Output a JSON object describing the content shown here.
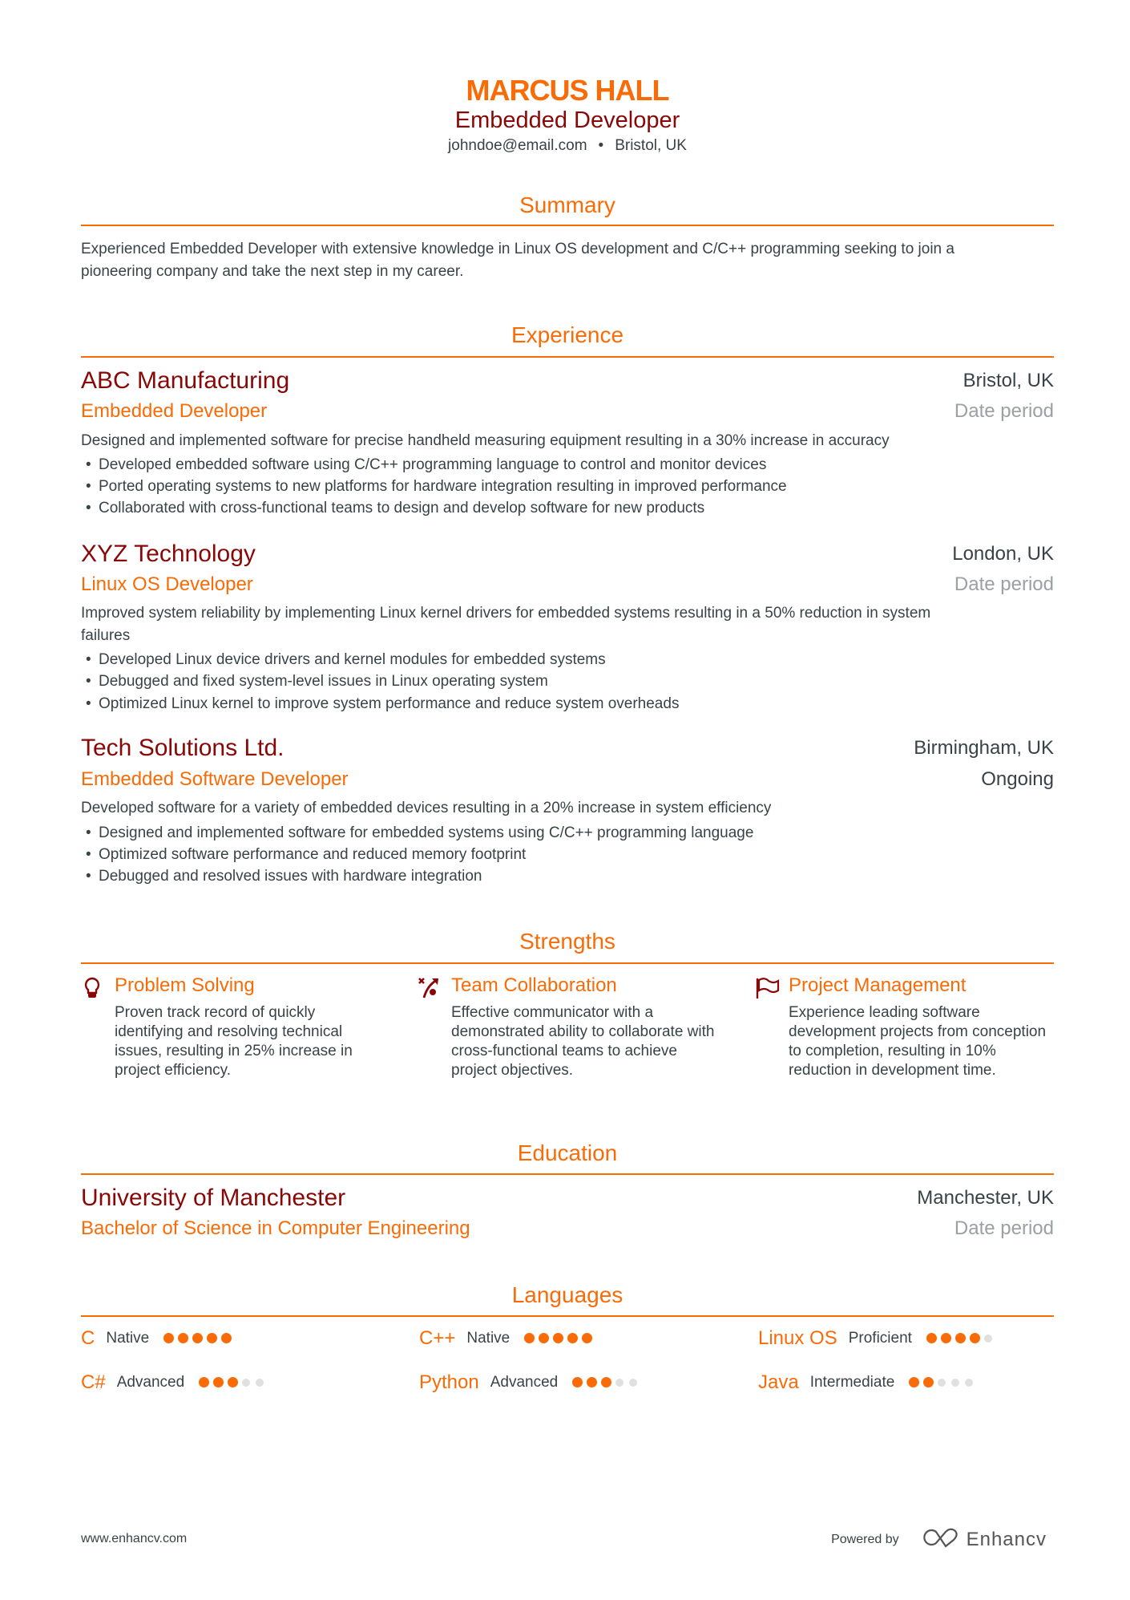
{
  "header": {
    "name": "MARCUS HALL",
    "title": "Embedded Developer",
    "email": "johndoe@email.com",
    "separator": "•",
    "location": "Bristol, UK"
  },
  "colors": {
    "accent": "#f96b07",
    "heading_dark": "#880808",
    "body": "#384347",
    "muted": "#9aa0a3"
  },
  "summary": {
    "heading": "Summary",
    "line1": "Experienced Embedded Developer with extensive knowledge in Linux OS development and C/C++ programming seeking to join a",
    "line2": "pioneering company and take the next step in my career."
  },
  "experience": {
    "heading": "Experience",
    "items": [
      {
        "company": "ABC Manufacturing",
        "location": "Bristol, UK",
        "role": "Embedded Developer",
        "date": "Date period",
        "description": [
          "Designed and implemented software for precise handheld measuring equipment resulting in a 30% increase in accuracy"
        ],
        "bullets": [
          "Developed embedded software using C/C++ programming language to control and monitor devices",
          "Ported operating systems to new platforms for hardware integration resulting in improved performance",
          "Collaborated with cross-functional teams to design and develop software for new products"
        ]
      },
      {
        "company": "XYZ Technology",
        "location": "London, UK",
        "role": "Linux OS Developer",
        "date": "Date period",
        "description": [
          "Improved system reliability by implementing Linux kernel drivers for embedded systems resulting in a 50% reduction in system",
          "failures"
        ],
        "bullets": [
          "Developed Linux device drivers and kernel modules for embedded systems",
          "Debugged and fixed system-level issues in Linux operating system",
          "Optimized Linux kernel to improve system performance and reduce system overheads"
        ]
      },
      {
        "company": "Tech Solutions Ltd.",
        "location": "Birmingham, UK",
        "role": "Embedded Software Developer",
        "date": "Ongoing",
        "description": [
          "Developed software for a variety of embedded devices resulting in a 20% increase in system efficiency"
        ],
        "bullets": [
          "Designed and implemented software for embedded systems using C/C++ programming language",
          "Optimized software performance and reduced memory footprint",
          "Debugged and resolved issues with hardware integration"
        ]
      }
    ],
    "bullet_char": "•"
  },
  "strengths": {
    "heading": "Strengths",
    "items": [
      {
        "icon": "lightbulb-icon",
        "title": "Problem Solving",
        "description": "Proven track record of quickly identifying and resolving technical issues, resulting in 25% increase in project efficiency."
      },
      {
        "icon": "strategy-icon",
        "title": "Team Collaboration",
        "description": "Effective communicator with a demonstrated ability to collaborate with cross-functional teams to achieve project objectives."
      },
      {
        "icon": "flag-icon",
        "title": "Project Management",
        "description": "Experience leading software development projects from conception to completion, resulting in 10% reduction in development time."
      }
    ]
  },
  "education": {
    "heading": "Education",
    "items": [
      {
        "school": "University of Manchester",
        "location": "Manchester, UK",
        "degree": "Bachelor of Science in Computer Engineering",
        "date": "Date period"
      }
    ]
  },
  "languages": {
    "heading": "Languages",
    "items": [
      {
        "name": "C",
        "level": "Native",
        "rating": 5,
        "max": 5
      },
      {
        "name": "C++",
        "level": "Native",
        "rating": 5,
        "max": 5
      },
      {
        "name": "Linux OS",
        "level": "Proficient",
        "rating": 4,
        "max": 5
      },
      {
        "name": "C#",
        "level": "Advanced",
        "rating": 3,
        "max": 5
      },
      {
        "name": "Python",
        "level": "Advanced",
        "rating": 3,
        "max": 5
      },
      {
        "name": "Java",
        "level": "Intermediate",
        "rating": 2,
        "max": 5
      }
    ]
  },
  "footer": {
    "website": "www.enhancv.com",
    "powered_by": "Powered by",
    "brand": "Enhancv"
  }
}
